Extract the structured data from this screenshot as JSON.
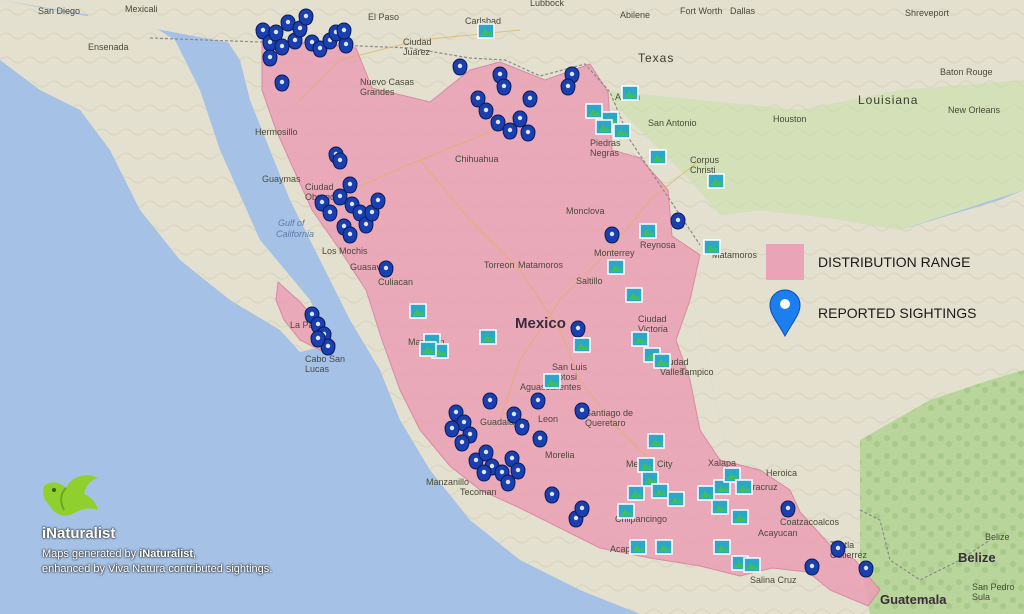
{
  "map": {
    "country_label": "Mexico",
    "country_labels": [
      {
        "id": "mexico",
        "text": "Mexico"
      },
      {
        "id": "belize",
        "text": "Belize"
      },
      {
        "id": "guatemala",
        "text": "Guatemala"
      }
    ],
    "water_labels": [
      {
        "id": "gulf-california",
        "text": "Gulf of\nCalifornia"
      }
    ],
    "state_labels": [
      {
        "id": "texas",
        "text": "Texas"
      },
      {
        "id": "louisiana",
        "text": "Louisiana"
      }
    ],
    "city_labels": [
      {
        "id": "san-diego",
        "text": "San Diego"
      },
      {
        "id": "mexicali",
        "text": "Mexicali"
      },
      {
        "id": "ensenada",
        "text": "Ensenada"
      },
      {
        "id": "lubbock",
        "text": "Lubbock"
      },
      {
        "id": "abilene",
        "text": "Abilene"
      },
      {
        "id": "fort-worth",
        "text": "Fort Worth"
      },
      {
        "id": "dallas",
        "text": "Dallas"
      },
      {
        "id": "shreveport",
        "text": "Shreveport"
      },
      {
        "id": "carlsbad",
        "text": "Carlsbad"
      },
      {
        "id": "ciudad-juarez",
        "text": "Ciudad\nJuarez"
      },
      {
        "id": "el-paso",
        "text": "El Paso"
      },
      {
        "id": "nuevo-casas-grandes",
        "text": "Nuevo Casas\nGrandes"
      },
      {
        "id": "hermosillo",
        "text": "Hermosillo"
      },
      {
        "id": "chihuahua",
        "text": "Chihuahua"
      },
      {
        "id": "austin",
        "text": "Austin"
      },
      {
        "id": "san-antonio",
        "text": "San Antonio"
      },
      {
        "id": "houston",
        "text": "Houston"
      },
      {
        "id": "baton-rouge",
        "text": "Baton Rouge"
      },
      {
        "id": "new-orleans",
        "text": "New Orleans"
      },
      {
        "id": "piedras-negras",
        "text": "Piedras\nNegras"
      },
      {
        "id": "corpus-christi",
        "text": "Corpus\nChristi"
      },
      {
        "id": "guaymas",
        "text": "Guaymas"
      },
      {
        "id": "ciudad-obregon",
        "text": "Ciudad\nObregon"
      },
      {
        "id": "monclova",
        "text": "Monclova"
      },
      {
        "id": "los-mochis",
        "text": "Los Mochis"
      },
      {
        "id": "guasave",
        "text": "Guasave"
      },
      {
        "id": "culiacan",
        "text": "Culiacan"
      },
      {
        "id": "torreon",
        "text": "Torreon"
      },
      {
        "id": "matamoros-dur",
        "text": "Matamoros"
      },
      {
        "id": "monterrey",
        "text": "Monterrey"
      },
      {
        "id": "reynosa",
        "text": "Reynosa"
      },
      {
        "id": "matamoros",
        "text": "Matamoros"
      },
      {
        "id": "saltillo",
        "text": "Saltillo"
      },
      {
        "id": "la-paz",
        "text": "La Paz"
      },
      {
        "id": "cabo-san-lucas",
        "text": "Cabo San\nLucas"
      },
      {
        "id": "mazatlan",
        "text": "Mazatlan"
      },
      {
        "id": "ciudad-victoria",
        "text": "Ciudad\nVictoria"
      },
      {
        "id": "ciudad-valles",
        "text": "Ciudad\nValles"
      },
      {
        "id": "san-luis-potosi",
        "text": "San Luis\nPotosi"
      },
      {
        "id": "aguascalientes",
        "text": "Aguascalientes"
      },
      {
        "id": "tampico",
        "text": "Tampico"
      },
      {
        "id": "guadalajara",
        "text": "Guadalajara"
      },
      {
        "id": "leon",
        "text": "Leon"
      },
      {
        "id": "queretaro",
        "text": "Santiago de\nQueretaro"
      },
      {
        "id": "morelia",
        "text": "Morelia"
      },
      {
        "id": "manzanillo",
        "text": "Manzanillo"
      },
      {
        "id": "tecoman",
        "text": "Tecoman"
      },
      {
        "id": "mexico-city",
        "text": "Mexico City"
      },
      {
        "id": "xalapa",
        "text": "Xalapa"
      },
      {
        "id": "veracruz",
        "text": "Veracruz"
      },
      {
        "id": "heroica",
        "text": "Heroica"
      },
      {
        "id": "coatzacoalcos",
        "text": "Coatzacoalcos"
      },
      {
        "id": "acayucan",
        "text": "Acayucan"
      },
      {
        "id": "chilpancingo",
        "text": "Chilpancingo"
      },
      {
        "id": "acapulco",
        "text": "Acapulco"
      },
      {
        "id": "salina-cruz",
        "text": "Salina Cruz"
      },
      {
        "id": "tuxtla",
        "text": "Tuxtla\nGutierrez"
      },
      {
        "id": "san-pedro-sula",
        "text": "San Pedro\nSula"
      },
      {
        "id": "belize-city",
        "text": "Belize"
      }
    ]
  },
  "legend": {
    "distribution_label": "DISTRIBUTION RANGE",
    "sightings_label": "REPORTED SIGHTINGS",
    "range_color": "#e9a1b5",
    "pin_color": "#1d7ef0"
  },
  "brand": {
    "name": "iNaturalist",
    "line1_prefix": "Maps generated by ",
    "line1_strong": "iNaturalist",
    "line1_suffix": ",",
    "line2": "enhanced by Viva Natura contributed sightings.",
    "logo_icon": "bird-icon"
  }
}
